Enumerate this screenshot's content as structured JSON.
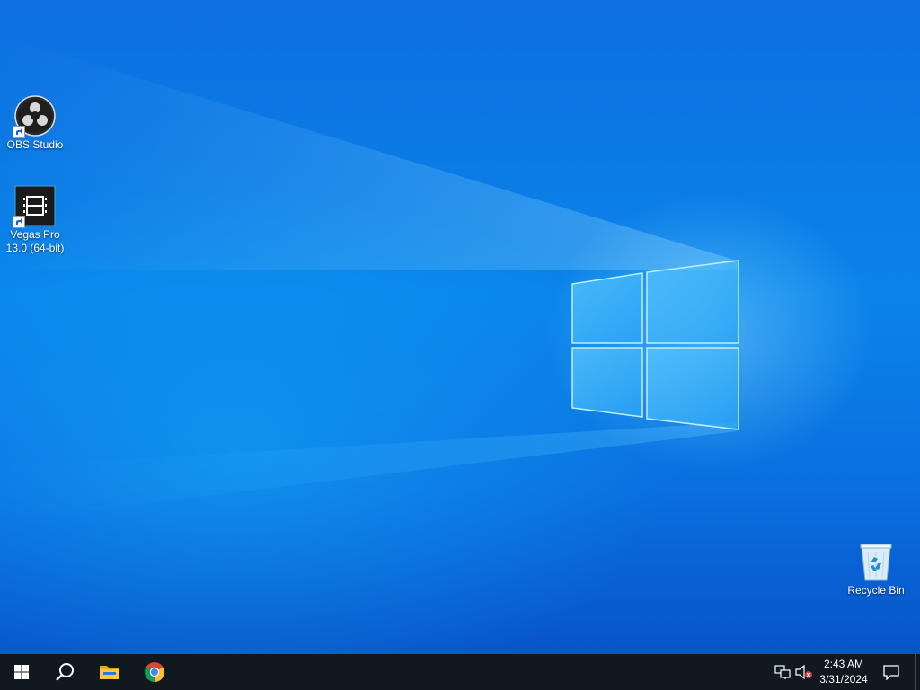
{
  "desktop": {
    "icons": [
      {
        "label": "OBS Studio",
        "icon": "obs-studio-icon"
      },
      {
        "label": "Vegas Pro 13.0 (64-bit)",
        "label_line1": "Vegas Pro",
        "label_line2": "13.0 (64-bit)",
        "icon": "vegas-pro-icon"
      },
      {
        "label": "Recycle Bin",
        "icon": "recycle-bin-icon"
      }
    ]
  },
  "taskbar": {
    "start": "windows-start-icon",
    "search": "search-icon",
    "pinned": [
      "file-explorer-icon",
      "chrome-icon"
    ],
    "tray": {
      "network": "network-icon",
      "volume": "volume-muted-icon",
      "time": "2:43 AM",
      "date": "3/31/2024",
      "notifications": "action-center-icon"
    }
  },
  "colors": {
    "taskbar_bg": "#101820",
    "desktop_accent": "#0a84ea"
  }
}
